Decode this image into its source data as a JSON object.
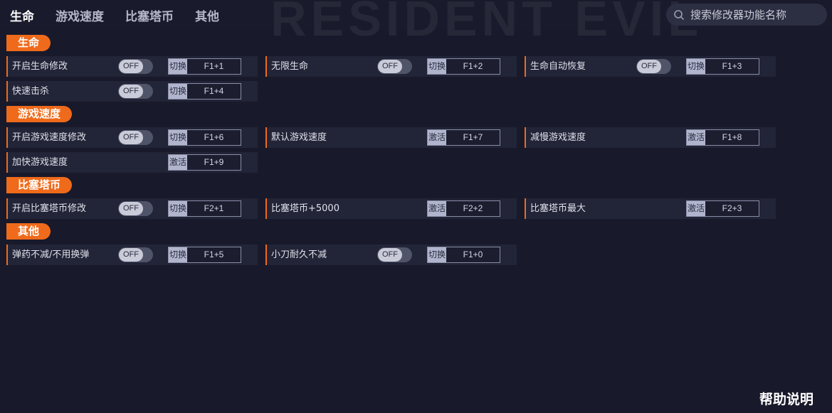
{
  "tabs": [
    "生命",
    "游戏速度",
    "比塞塔币",
    "其他"
  ],
  "search": {
    "placeholder": "搜索修改器功能名称"
  },
  "watermark": "RESIDENT EVIL",
  "sections": [
    {
      "title": "生命",
      "rows": [
        {
          "label": "开启生命修改",
          "toggle": "OFF",
          "mode": "切换",
          "key": "F1+1"
        },
        {
          "label": "无限生命",
          "toggle": "OFF",
          "mode": "切换",
          "key": "F1+2"
        },
        {
          "label": "生命自动恢复",
          "toggle": "OFF",
          "mode": "切换",
          "key": "F1+3"
        },
        {
          "label": "快速击杀",
          "toggle": "OFF",
          "mode": "切换",
          "key": "F1+4"
        }
      ]
    },
    {
      "title": "游戏速度",
      "rows": [
        {
          "label": "开启游戏速度修改",
          "toggle": "OFF",
          "mode": "切换",
          "key": "F1+6"
        },
        {
          "label": "默认游戏速度",
          "toggle": null,
          "mode": "激活",
          "key": "F1+7"
        },
        {
          "label": "减慢游戏速度",
          "toggle": null,
          "mode": "激活",
          "key": "F1+8"
        },
        {
          "label": "加快游戏速度",
          "toggle": null,
          "mode": "激活",
          "key": "F1+9"
        }
      ]
    },
    {
      "title": "比塞塔币",
      "rows": [
        {
          "label": "开启比塞塔币修改",
          "toggle": "OFF",
          "mode": "切换",
          "key": "F2+1"
        },
        {
          "label": "比塞塔币+5000",
          "toggle": null,
          "mode": "激活",
          "key": "F2+2"
        },
        {
          "label": "比塞塔币最大",
          "toggle": null,
          "mode": "激活",
          "key": "F2+3"
        }
      ]
    },
    {
      "title": "其他",
      "rows": [
        {
          "label": "弹药不减/不用换弹",
          "toggle": "OFF",
          "mode": "切换",
          "key": "F1+5"
        },
        {
          "label": "小刀耐久不减",
          "toggle": "OFF",
          "mode": "切换",
          "key": "F1+0"
        }
      ]
    }
  ],
  "help": "帮助说明",
  "colors": {
    "accent": "#ef6a1a",
    "background": "#181a2b",
    "row": "#222437"
  }
}
